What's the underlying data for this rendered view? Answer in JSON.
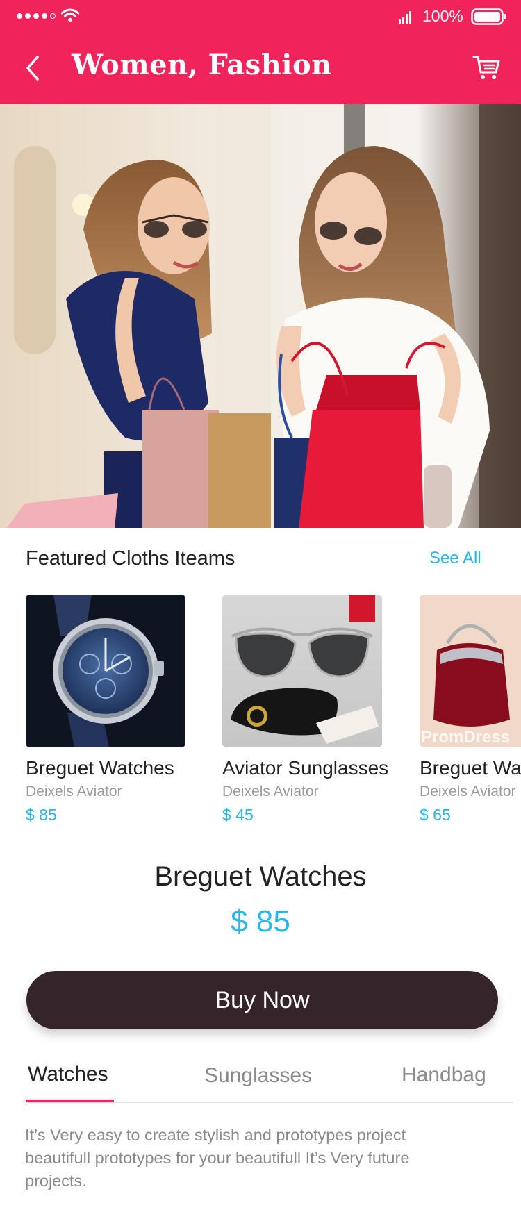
{
  "status_bar": {
    "battery": "100%"
  },
  "header": {
    "title": "Women, Fashion"
  },
  "featured": {
    "title": "Featured Cloths Iteams",
    "see_all": "See All",
    "items": [
      {
        "name": "Breguet Watches",
        "sub": "Deixels Aviator",
        "price": "$ 85",
        "image": "watch"
      },
      {
        "name": "Aviator Sunglasses",
        "sub": "Deixels Aviator",
        "price": "$ 45",
        "image": "sunglasses"
      },
      {
        "name": "Breguet Watches",
        "sub": "Deixels Aviator",
        "price": "$ 65",
        "image": "handbag",
        "watermark": "PromDress"
      }
    ]
  },
  "selected": {
    "name": "Breguet Watches",
    "price": "$ 85"
  },
  "buy_button": "Buy Now",
  "tabs": [
    "Watches",
    "Sunglasses",
    "Handbag"
  ],
  "description": "It’s Very easy to create stylish and prototypes  project beautifull prototypes for your beautifull It’s Very future projects.",
  "colors": {
    "brand": "#f0245b",
    "accent": "#29b6e8",
    "button": "#35242a"
  }
}
